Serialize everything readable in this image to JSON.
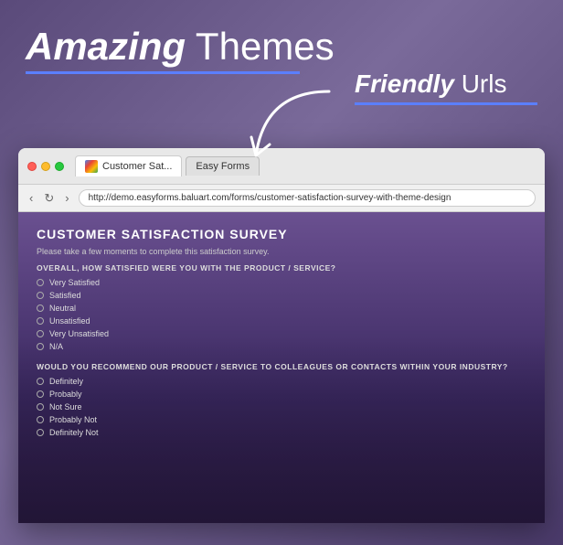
{
  "header": {
    "title_bold": "Amazing",
    "title_light": " Themes",
    "underline_color": "#5b7fff"
  },
  "friendly_urls": {
    "bold": "Friendly",
    "light": " Urls"
  },
  "browser": {
    "tab_active_label": "Customer Sat...",
    "tab_inactive_label": "Easy Forms",
    "url": "http://demo.easyforms.baluart.com/forms/customer-satisfaction-survey-with-theme-design",
    "nav_back": "‹",
    "nav_forward": "›",
    "nav_refresh": "↻"
  },
  "survey": {
    "title": "CUSTOMER SATISFACTION SURVEY",
    "description": "Please take a few moments to complete this satisfaction survey.",
    "question1": "OVERALL, HOW SATISFIED WERE YOU WITH THE PRODUCT / SERVICE?",
    "options1": [
      "Very Satisfied",
      "Satisfied",
      "Neutral",
      "Unsatisfied",
      "Very Unsatisfied",
      "N/A"
    ],
    "question2": "WOULD YOU RECOMMEND OUR PRODUCT / SERVICE TO COLLEAGUES OR CONTACTS WITHIN YOUR INDUSTRY?",
    "options2": [
      "Definitely",
      "Probably",
      "Not Sure",
      "Probably Not",
      "Definitely Not"
    ]
  }
}
